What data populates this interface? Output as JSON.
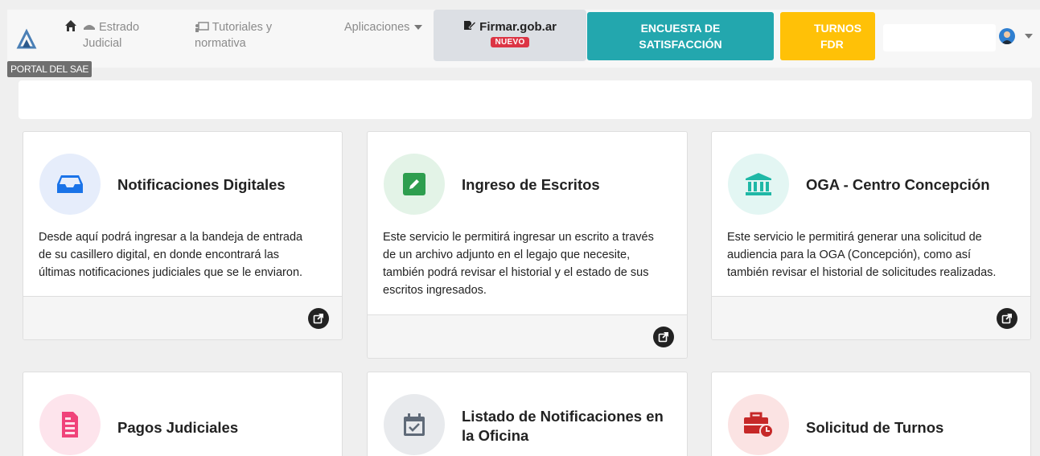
{
  "nav": {
    "portal_tooltip": "PORTAL DEL SAE",
    "estrado_line1": "Estrado",
    "estrado_line2": "Judicial",
    "tutoriales_line1": "Tutoriales y",
    "tutoriales_line2": "normativa",
    "aplicaciones": "Aplicaciones",
    "firmar_label": "Firmar.gob.ar",
    "firmar_badge": "NUEVO",
    "encuesta_line1": "ENCUESTA DE",
    "encuesta_line2": "SATISFACCIÓN",
    "turnos_line1": "TURNOS",
    "turnos_line2": "FDR"
  },
  "cards": [
    {
      "title": "Notificaciones Digitales",
      "icon": "inbox-icon",
      "desc_lines": [
        "Desde aquí podrá ingresar a la bandeja de entrada",
        "de su casillero digital, en donde encontrará las",
        "últimas notificaciones judiciales que se le enviaron."
      ]
    },
    {
      "title": "Ingreso de Escritos",
      "icon": "edit-icon",
      "desc_lines": [
        "Este servicio le permitirá ingresar un escrito a través",
        "de un archivo adjunto en el legajo que necesite,",
        "también podrá revisar el historial y el estado de sus",
        "escritos ingresados."
      ]
    },
    {
      "title": "OGA - Centro Concepción",
      "icon": "institution-icon",
      "desc_lines": [
        "Este servicio le permitirá generar una solicitud de",
        "audiencia para la OGA (Concepción), como así",
        "también revisar el historial de solicitudes realizadas."
      ]
    },
    {
      "title": "Pagos Judiciales",
      "icon": "receipt-icon"
    },
    {
      "title_line1": "Listado de Notificaciones en",
      "title_line2": "la Oficina",
      "icon": "calendar-check-icon"
    },
    {
      "title": "Solicitud de Turnos",
      "icon": "briefcase-clock-icon"
    }
  ],
  "colors": {
    "encuesta": "#23a7ae",
    "turnos": "#ffc107",
    "badge": "#dc3545",
    "notif_icon": "#1a73e8",
    "escritos_icon": "#2e9e4f",
    "oga_icon": "#1fb8a6",
    "pagos_icon": "#f0437a",
    "listado_icon": "#5f6a78",
    "turnos_icon": "#c62828"
  }
}
